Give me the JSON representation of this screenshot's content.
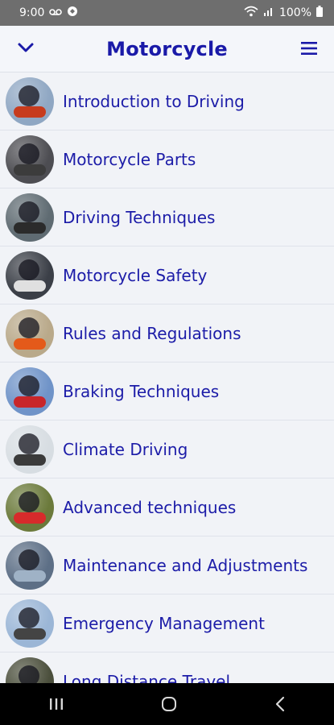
{
  "status": {
    "time": "9:00",
    "battery": "100%"
  },
  "header": {
    "title": "Motorcycle"
  },
  "topics": [
    {
      "label": "Introduction to Driving",
      "thumb_bg": "#8fa7c3",
      "accent": "#c73b1d"
    },
    {
      "label": "Motorcycle Parts",
      "thumb_bg": "#4d4d52",
      "accent": "#3c3c3c"
    },
    {
      "label": "Driving Techniques",
      "thumb_bg": "#5f6b72",
      "accent": "#2b2b2b"
    },
    {
      "label": "Motorcycle Safety",
      "thumb_bg": "#3b3f47",
      "accent": "#e0e0e0"
    },
    {
      "label": "Rules and Regulations",
      "thumb_bg": "#b9a98a",
      "accent": "#e45a1a"
    },
    {
      "label": "Braking Techniques",
      "thumb_bg": "#6f93c8",
      "accent": "#c8262a"
    },
    {
      "label": "Climate Driving",
      "thumb_bg": "#d7dde2",
      "accent": "#3a3a3a"
    },
    {
      "label": "Advanced techniques",
      "thumb_bg": "#6b7a3b",
      "accent": "#d72b2b"
    },
    {
      "label": "Maintenance and Adjustments",
      "thumb_bg": "#5d6f86",
      "accent": "#9fb2c6"
    },
    {
      "label": "Emergency Management",
      "thumb_bg": "#9bb6d6",
      "accent": "#444444"
    },
    {
      "label": "Long Distance Travel",
      "thumb_bg": "#4b4f3c",
      "accent": "#222222"
    }
  ],
  "colors": {
    "accent": "#1a1aa8",
    "list_bg": "#f1f3f7",
    "status_bg": "#6e6e6e"
  }
}
